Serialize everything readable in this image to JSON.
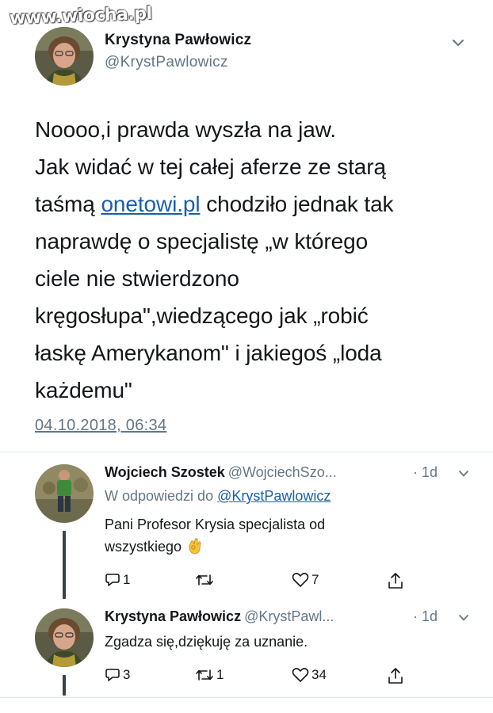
{
  "watermark": "www.wiocha.pl",
  "main_tweet": {
    "name": "Krystyna Pawłowicz",
    "handle": "@KrystPawlowicz",
    "text_lines": [
      "Noooo,i prawda wyszła na jaw.",
      "Jak widać w tej całej aferze ze starą",
      "taśmą ",
      "onetowi.pl",
      " chodziło  jednak tak",
      "naprawdę o specjalistę „w którego",
      "ciele nie stwierdzono",
      "kręgosłupa\",wiedzącego jak „robić",
      "łaskę Amerykanom\" i jakiegoś „loda",
      "każdemu\""
    ],
    "timestamp": "04.10.2018, 06:34"
  },
  "replies": [
    {
      "name": "Wojciech Szostek",
      "handle": "@WojciechSzo...",
      "time": "· 1d",
      "reply_to_prefix": "W odpowiedzi do ",
      "reply_to_handle": "@KrystPawlowicz",
      "body_lines": [
        "Pani Profesor Krysia specjalista od",
        "wszystkiego"
      ],
      "emoji": "ok-hand-emoji",
      "actions": {
        "replies": "1",
        "retweets": "",
        "likes": "7"
      }
    },
    {
      "name": "Krystyna Pawłowicz",
      "handle": "@KrystPawl...",
      "time": "· 1d",
      "body_lines": [
        "Zgadza się,dziękuję za uznanie."
      ],
      "actions": {
        "replies": "3",
        "retweets": "1",
        "likes": "34"
      }
    }
  ],
  "icons": {
    "reply": "reply-icon",
    "retweet": "retweet-icon",
    "like": "heart-icon",
    "share": "share-icon",
    "menu": "chevron-down-icon"
  },
  "colors": {
    "text": "#14171a",
    "secondary": "#657786",
    "link": "#1b5fa8",
    "divider": "#e1e8ed"
  }
}
